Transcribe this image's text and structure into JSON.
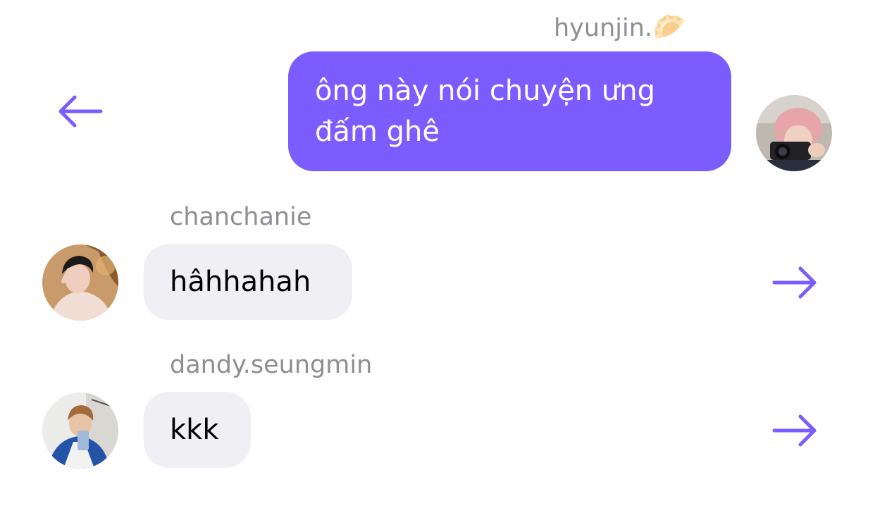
{
  "accent_color": "#7b5cff",
  "messages": [
    {
      "direction": "outgoing",
      "sender": "hyunjin.",
      "sender_emoji": "🥟",
      "lines": [
        "ông này nói chuyện ưng",
        "đấm ghê"
      ],
      "action_icon": "arrow-left-icon"
    },
    {
      "direction": "incoming",
      "sender": "chanchanie",
      "text": "hâhhahah",
      "action_icon": "arrow-right-icon"
    },
    {
      "direction": "incoming",
      "sender": "dandy.seungmin",
      "text": "kkk",
      "action_icon": "arrow-right-icon"
    }
  ]
}
